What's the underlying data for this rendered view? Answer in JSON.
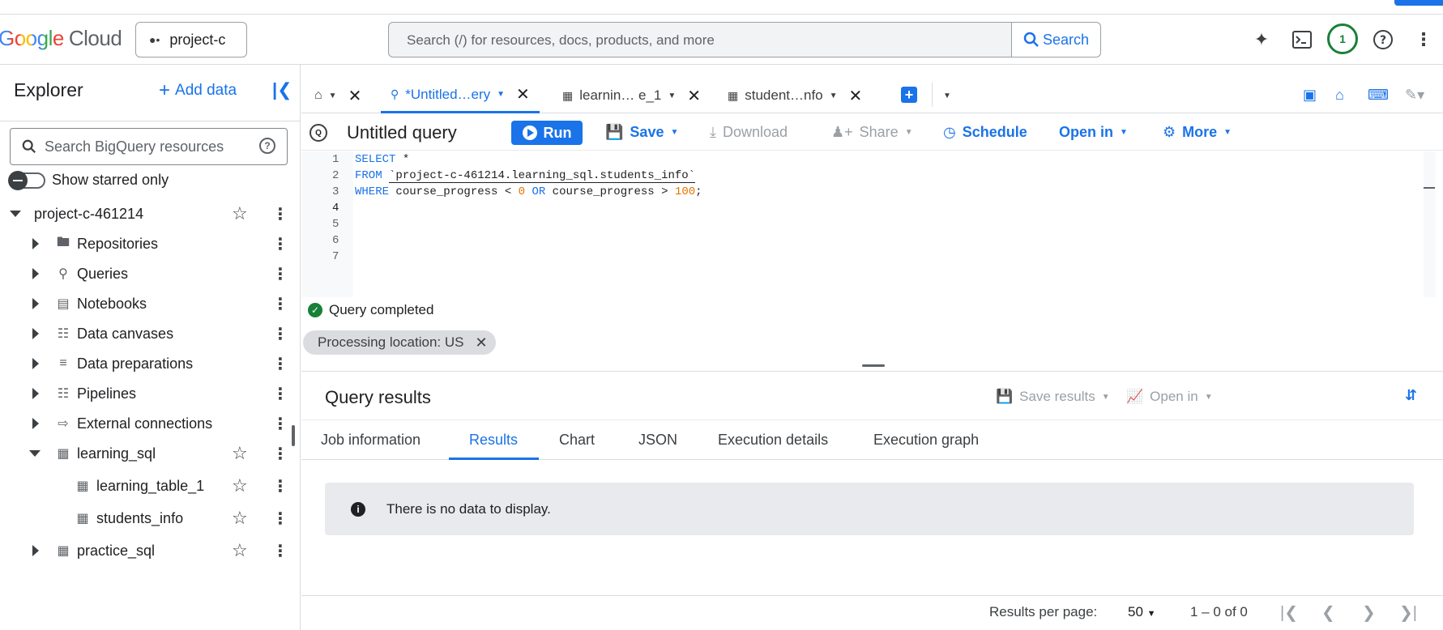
{
  "header": {
    "logo_google": "Google",
    "logo_cloud": "Cloud",
    "project_selector": "project-c",
    "search_placeholder": "Search (/) for resources, docs, products, and more",
    "search_button": "Search",
    "notification_count": "1"
  },
  "sidebar": {
    "title": "Explorer",
    "add_data": "Add data",
    "search_placeholder": "Search BigQuery resources",
    "show_starred": "Show starred only",
    "project": "project-c-461214",
    "items": [
      {
        "label": "Repositories"
      },
      {
        "label": "Queries"
      },
      {
        "label": "Notebooks"
      },
      {
        "label": "Data canvases"
      },
      {
        "label": "Data preparations"
      },
      {
        "label": "Pipelines"
      },
      {
        "label": "External connections"
      },
      {
        "label": "learning_sql"
      },
      {
        "label": "learning_table_1"
      },
      {
        "label": "students_info"
      },
      {
        "label": "practice_sql"
      }
    ]
  },
  "tabs": [
    {
      "label": "*Untitled…ery"
    },
    {
      "label": "learnin…  e_1"
    },
    {
      "label": "student…nfo"
    }
  ],
  "toolbar": {
    "query_title": "Untitled query",
    "run": "Run",
    "save": "Save",
    "download": "Download",
    "share": "Share",
    "schedule": "Schedule",
    "open_in": "Open in",
    "more": "More"
  },
  "editor": {
    "line_numbers": [
      "1",
      "2",
      "3",
      "4",
      "5",
      "6",
      "7"
    ],
    "line1_kw": "SELECT",
    "line1_rest": " *",
    "line2_kw": "FROM",
    "line2_table": "`project-c-461214.learning_sql.students_info`",
    "line3_kw1": "WHERE",
    "line3_a": " course_progress < ",
    "line3_n1": "0",
    "line3_kw2": " OR",
    "line3_b": " course_progress > ",
    "line3_n2": "100",
    "line3_end": ";"
  },
  "status": {
    "message": "Query completed",
    "chip": "Processing location: US"
  },
  "results": {
    "title": "Query results",
    "save_results": "Save results",
    "open_in": "Open in",
    "tabs": [
      "Job information",
      "Results",
      "Chart",
      "JSON",
      "Execution details",
      "Execution graph"
    ],
    "empty_message": "There is no data to display.",
    "per_page_label": "Results per page:",
    "per_page_value": "50",
    "range": "1 – 0 of 0"
  },
  "colors": {
    "accent": "#1a73e8",
    "success": "#188038"
  }
}
